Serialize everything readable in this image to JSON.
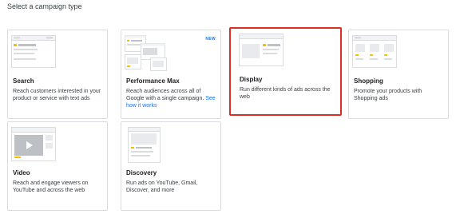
{
  "page_title_partial": "",
  "heading": "Select a campaign type",
  "colors": {
    "accent_yellow": "#fbbc04",
    "selected_border": "#d93025",
    "link": "#1a73e8"
  },
  "campaigns": [
    {
      "id": "search",
      "title": "Search",
      "description": "Reach customers interested in your product or service with text ads",
      "icon": "search-ads-illustration"
    },
    {
      "id": "performance-max",
      "title": "Performance Max",
      "description": "Reach audiences across all of Google with a single campaign.",
      "link_text": "See how it works",
      "badge": "NEW",
      "icon": "performance-max-illustration"
    },
    {
      "id": "display",
      "title": "Display",
      "description": "Run different kinds of ads across the web",
      "selected": true,
      "icon": "display-ads-illustration"
    },
    {
      "id": "shopping",
      "title": "Shopping",
      "description": "Promote your products with Shopping ads",
      "icon": "shopping-ads-illustration"
    },
    {
      "id": "video",
      "title": "Video",
      "description": "Reach and engage viewers on YouTube and across the web",
      "icon": "video-ads-illustration"
    },
    {
      "id": "discovery",
      "title": "Discovery",
      "description": "Run ads on YouTube, Gmail, Discover, and more",
      "icon": "discovery-ads-illustration"
    }
  ]
}
